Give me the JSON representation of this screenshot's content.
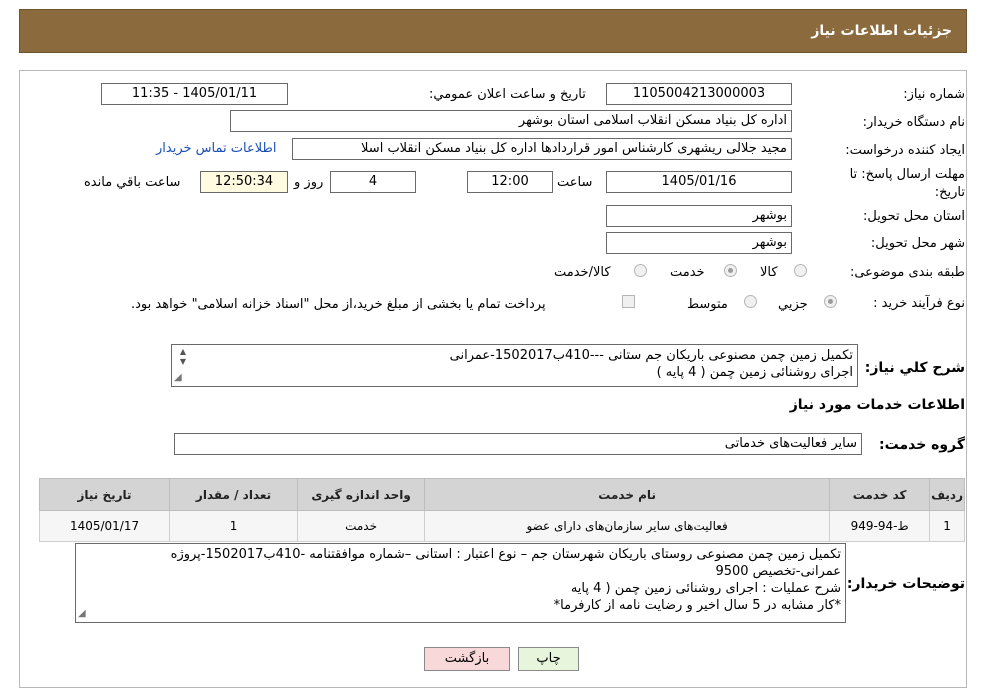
{
  "header": {
    "title": "جزئیات اطلاعات نیاز"
  },
  "fields": {
    "need_number_label": "شماره نیاز:",
    "need_number": "1105004213000003",
    "announce_label": "تاریخ و ساعت اعلان عمومي:",
    "announce_value": "1405/01/11 - 11:35",
    "buyer_org_label": "نام دستگاه خريدار:",
    "buyer_org": "اداره کل بنیاد مسکن انقلاب اسلامی استان بوشهر",
    "creator_label": "ايجاد کننده درخواست:",
    "creator": "مجید جلالی ریشهری کارشناس امور قراردادها اداره کل بنیاد مسکن انقلاب اسلا",
    "contact_link": "اطلاعات تماس خريدار",
    "deadline_label": "مهلت ارسال پاسخ: تا تاريخ:",
    "deadline_date": "1405/01/16",
    "time_label": "ساعت",
    "deadline_time": "12:00",
    "days": "4",
    "days_label": "روز و",
    "remaining": "12:50:34",
    "remaining_label": "ساعت باقي مانده",
    "province_label": "استان محل تحويل:",
    "province": "بوشهر",
    "city_label": "شهر محل تحويل:",
    "city": "بوشهر",
    "category_label": "طبقه بندی موضوعی:",
    "category_options": [
      "کالا",
      "خدمت",
      "کالا/خدمت"
    ],
    "process_label": "نوع فرآيند خريد :",
    "process_options": [
      "جزيي",
      "متوسط"
    ],
    "payment_note": "پرداخت تمام یا بخشی از مبلغ خرید،از محل \"اسناد خزانه اسلامی\" خواهد بود."
  },
  "summary": {
    "label": "شرح كلي نياز:",
    "lines": [
      "تکمیل زمین چمن مصنوعی باریکان جم ستانی ---410ب1502017-عمرانی",
      "اجرای روشنائی زمین چمن ( 4 پایه )"
    ]
  },
  "services_section": {
    "title": "اطلاعات خدمات مورد نياز",
    "group_label": "گروه خدمت:",
    "group_value": "ساير فعاليت‌هاى خدماتى"
  },
  "table": {
    "headers": [
      "رديف",
      "کد خدمت",
      "نام خدمت",
      "واحد اندازه گيری",
      "تعداد / مقدار",
      "تاريخ نياز"
    ],
    "rows": [
      [
        "1",
        "ط-94-949",
        "فعاليت‌هاى ساير سازمان‌هاى داراى عضو",
        "خدمت",
        "1",
        "1405/01/17"
      ]
    ]
  },
  "buyer_notes": {
    "label": "توضيحات خريدار:",
    "lines": [
      "تکمیل زمین چمن مصنوعی روستای باریکان  شهرستان جم – نوع اعتبار : استانی –شماره موافقتنامه -410ب1502017-پروژه",
      "عمرانی-تخصیص 9500",
      "شرح عملیات : اجرای روشنائی زمین چمن ( 4 پایه",
      "*کار مشابه در 5 سال اخیر و رضایت نامه از کارفرما*"
    ]
  },
  "buttons": {
    "print": "چاپ",
    "back": "بازگشت"
  },
  "colors": {
    "header_bg": "#8b6b3d",
    "back_btn": "#f8d8d8",
    "print_btn": "#e6f5dc",
    "link": "#1a4fb5"
  }
}
